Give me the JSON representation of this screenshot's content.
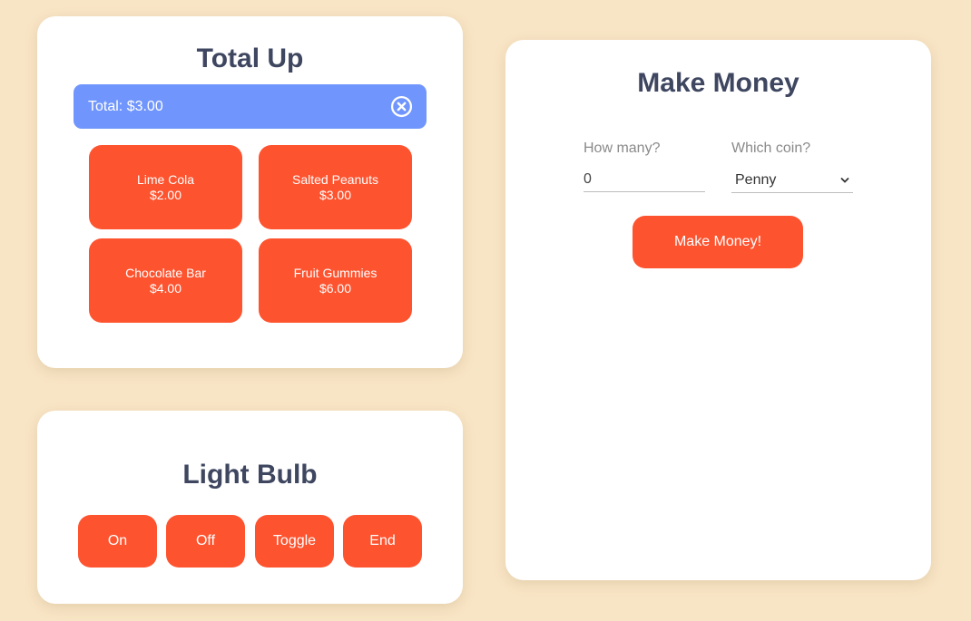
{
  "total_up": {
    "title": "Total Up",
    "total_label": "Total: $3.00",
    "clear_icon": "close-circle-icon",
    "items": [
      {
        "name": "Lime Cola",
        "price": "$2.00"
      },
      {
        "name": "Salted Peanuts",
        "price": "$3.00"
      },
      {
        "name": "Chocolate Bar",
        "price": "$4.00"
      },
      {
        "name": "Fruit Gummies",
        "price": "$6.00"
      }
    ]
  },
  "light_bulb": {
    "title": "Light Bulb",
    "buttons": [
      "On",
      "Off",
      "Toggle",
      "End"
    ]
  },
  "make_money": {
    "title": "Make Money",
    "how_many_label": "How many?",
    "how_many_value": "0",
    "which_coin_label": "Which coin?",
    "which_coin_value": "Penny",
    "submit_label": "Make Money!"
  },
  "colors": {
    "background": "#f8e5c5",
    "accent": "#fe532f",
    "total_bar": "#7096fd",
    "title_text": "#3e4660"
  }
}
